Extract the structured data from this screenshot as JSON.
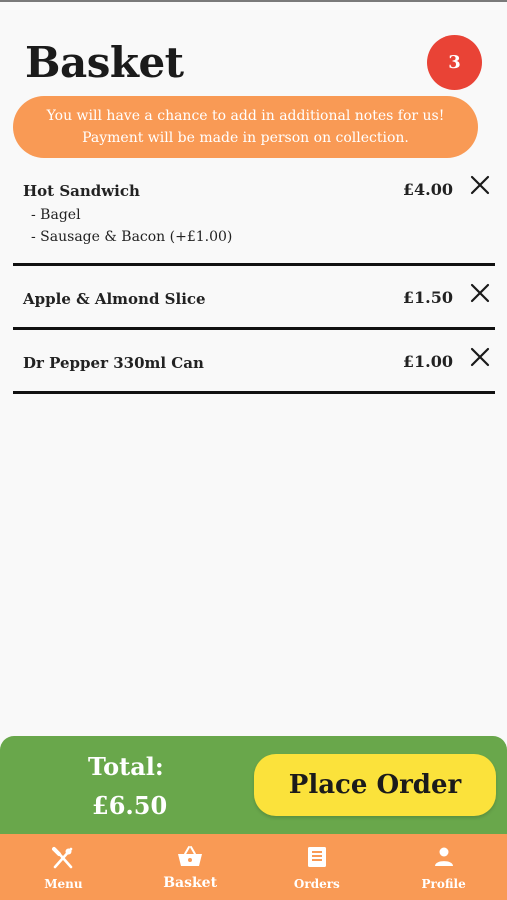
{
  "header": {
    "title": "Basket",
    "badge_count": "3"
  },
  "notice": {
    "line1": "You will have a chance to add in additional notes for us!",
    "line2": "Payment will be made in person on collection."
  },
  "items": [
    {
      "name": "Hot Sandwich",
      "options": [
        "- Bagel",
        "- Sausage & Bacon (+£1.00)"
      ],
      "price": "£4.00"
    },
    {
      "name": "Apple & Almond Slice",
      "options": [],
      "price": "£1.50"
    },
    {
      "name": "Dr Pepper 330ml Can",
      "options": [],
      "price": "£1.00"
    }
  ],
  "footer": {
    "total_label": "Total:",
    "total_value": "£6.50",
    "place_order_label": "Place Order"
  },
  "nav": [
    {
      "label": "Menu",
      "icon": "utensils-icon"
    },
    {
      "label": "Basket",
      "icon": "basket-icon"
    },
    {
      "label": "Orders",
      "icon": "receipt-icon"
    },
    {
      "label": "Profile",
      "icon": "person-icon"
    }
  ],
  "colors": {
    "badge": "#e94336",
    "notice": "#f99a55",
    "bottom_bar": "#69a74b",
    "button": "#fbe23b",
    "nav": "#f99a55"
  }
}
